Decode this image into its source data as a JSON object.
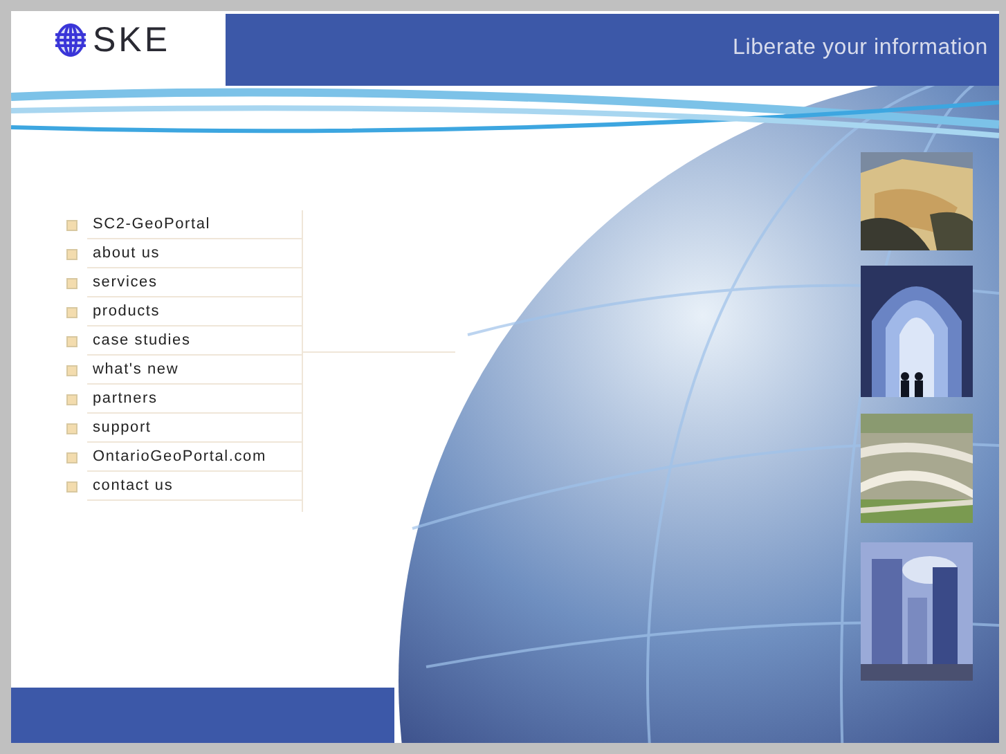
{
  "header": {
    "logo_text": "SKE",
    "tagline": "Liberate your information"
  },
  "menu": [
    {
      "label": "SC2-GeoPortal"
    },
    {
      "label": "about us"
    },
    {
      "label": "services"
    },
    {
      "label": "products"
    },
    {
      "label": "case studies"
    },
    {
      "label": "what's new"
    },
    {
      "label": "partners"
    },
    {
      "label": "support"
    },
    {
      "label": "OntarioGeoPortal.com"
    },
    {
      "label": "contact us"
    }
  ]
}
